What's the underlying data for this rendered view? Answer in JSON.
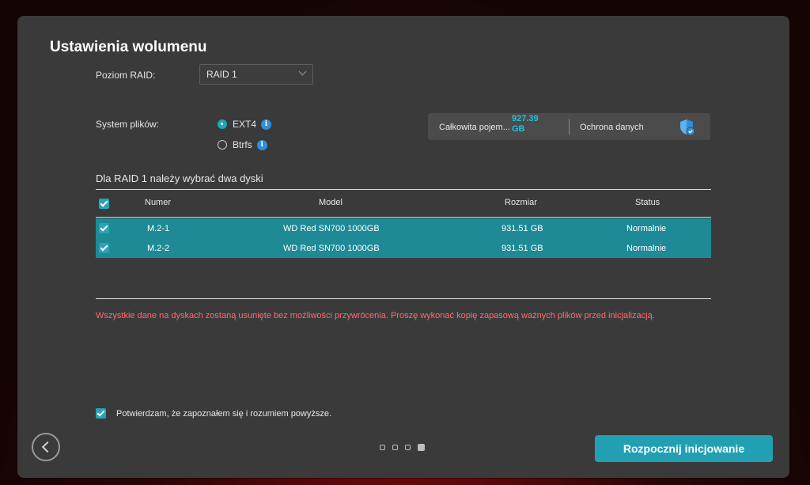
{
  "title": "Ustawienia wolumenu",
  "raid": {
    "label": "Poziom RAID:",
    "selected": "RAID 1"
  },
  "filesystem": {
    "label": "System plików:",
    "options": [
      {
        "label": "EXT4",
        "selected": true
      },
      {
        "label": "Btrfs",
        "selected": false
      }
    ]
  },
  "capacity": {
    "label": "Całkowita pojem...",
    "value": "927.39 GB",
    "protection_label": "Ochrona danych"
  },
  "disks": {
    "note": "Dla RAID 1 należy wybrać dwa dyski",
    "columns": [
      "Numer",
      "Model",
      "Rozmiar",
      "Status"
    ],
    "rows": [
      {
        "number": "M.2-1",
        "model": "WD Red SN700 1000GB",
        "size": "931.51 GB",
        "status": "Normalnie",
        "checked": true
      },
      {
        "number": "M.2-2",
        "model": "WD Red SN700 1000GB",
        "size": "931.51 GB",
        "status": "Normalnie",
        "checked": true
      }
    ]
  },
  "warning": "Wszystkie dane na dyskach zostaną usunięte bez możliwości przywrócenia. Proszę wykonać kopię zapasową ważnych plików przed inicjalizacją.",
  "confirm_text": "Potwierdzam, że zapoznałem się i rozumiem powyższe.",
  "pagination": {
    "current": 4,
    "total": 4
  },
  "start_button": "Rozpocznij inicjowanie",
  "colors": {
    "accent": "#21a0b3",
    "row_selected": "#1d8a96",
    "warning": "#ff6b6b",
    "capacity_value": "#1fc3d8"
  }
}
